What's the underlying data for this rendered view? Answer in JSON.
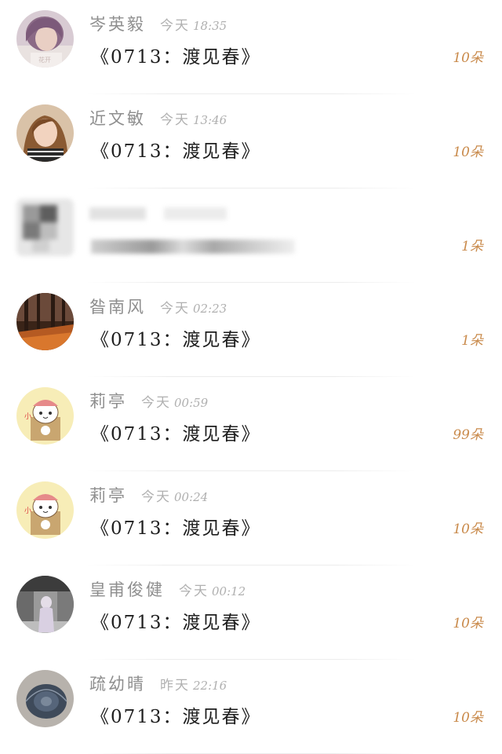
{
  "gifts": [
    {
      "name": "岑英毅",
      "day": "今天",
      "time": "18:35",
      "title": "《0713：渡见春》",
      "count": "10朵",
      "avatar": "woman-purple-hair-avatar"
    },
    {
      "name": "近文敏",
      "day": "今天",
      "time": "13:46",
      "title": "《0713：渡见春》",
      "count": "10朵",
      "avatar": "woman-selfie-avatar"
    },
    {
      "name": "",
      "day": "",
      "time": "",
      "title": "",
      "count": "1朵",
      "avatar": "blurred-avatar"
    },
    {
      "name": "昝南风",
      "day": "今天",
      "time": "02:23",
      "title": "《0713：渡见春》",
      "count": "1朵",
      "avatar": "autumn-forest-avatar"
    },
    {
      "name": "莉亭",
      "day": "今天",
      "time": "00:59",
      "title": "《0713：渡见春》",
      "count": "99朵",
      "avatar": "cartoon-cat-avatar"
    },
    {
      "name": "莉亭",
      "day": "今天",
      "time": "00:24",
      "title": "《0713：渡见春》",
      "count": "10朵",
      "avatar": "cartoon-cat-avatar"
    },
    {
      "name": "皇甫俊健",
      "day": "今天",
      "time": "00:12",
      "title": "《0713：渡见春》",
      "count": "10朵",
      "avatar": "street-figure-avatar"
    },
    {
      "name": "疏幼晴",
      "day": "昨天",
      "time": "22:16",
      "title": "《0713：渡见春》",
      "count": "10朵",
      "avatar": "snail-shell-avatar"
    }
  ]
}
